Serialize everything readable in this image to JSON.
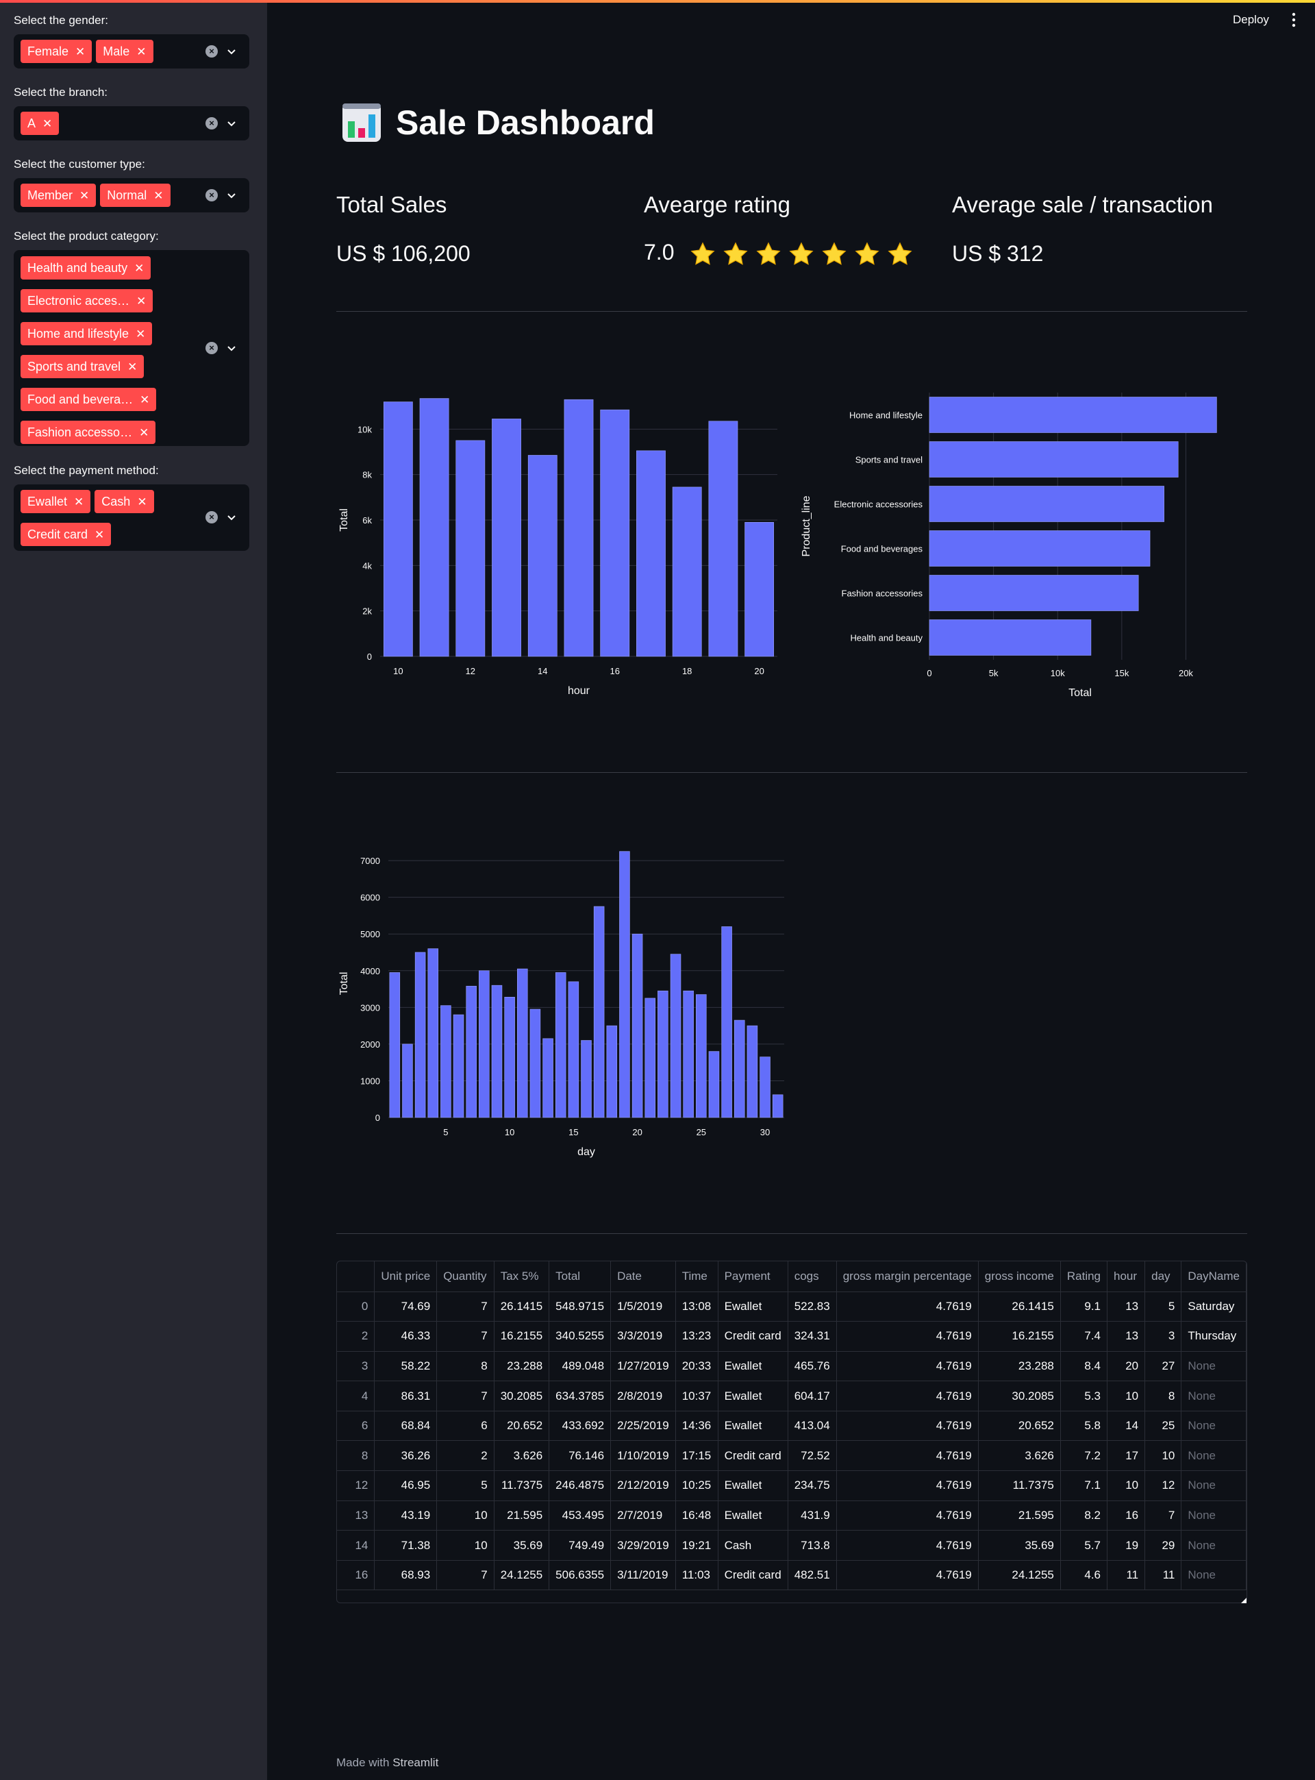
{
  "app": {
    "deploy_label": "Deploy",
    "title": "Sale Dashboard",
    "footer_prefix": "Made with",
    "footer_brand": "Streamlit"
  },
  "sidebar": {
    "gender": {
      "label": "Select the gender:",
      "selected": [
        "Female",
        "Male"
      ]
    },
    "branch": {
      "label": "Select the branch:",
      "selected": [
        "A"
      ]
    },
    "customer_type": {
      "label": "Select the customer type:",
      "selected": [
        "Member",
        "Normal"
      ]
    },
    "product_category": {
      "label": "Select the product category:",
      "selected": [
        "Health and beauty",
        "Electronic acces…",
        "Home and lifestyle",
        "Sports and travel",
        "Food and bevera…",
        "Fashion accesso…"
      ]
    },
    "payment_method": {
      "label": "Select the payment method:",
      "selected": [
        "Ewallet",
        "Cash",
        "Credit card"
      ]
    }
  },
  "metrics": {
    "total_sales": {
      "title": "Total Sales",
      "value": "US $ 106,200"
    },
    "avg_rating": {
      "title": "Avearge rating",
      "value": "7.0",
      "stars": 7
    },
    "avg_sale": {
      "title": "Average sale / transaction",
      "value": "US $ 312"
    }
  },
  "colors": {
    "bar": "#636efa",
    "chip": "#ff4b4b",
    "star": "#fdd835"
  },
  "chart_data": [
    {
      "type": "bar",
      "xlabel": "hour",
      "ylabel": "Total",
      "x": [
        10,
        11,
        12,
        13,
        14,
        15,
        16,
        17,
        18,
        19,
        20
      ],
      "values": [
        11200,
        11350,
        9500,
        10450,
        8850,
        11300,
        10850,
        9050,
        7450,
        10350,
        5900
      ],
      "xticks": [
        10,
        12,
        14,
        16,
        18,
        20
      ],
      "yticks": [
        "0",
        "2k",
        "4k",
        "6k",
        "8k",
        "10k"
      ],
      "ylim": [
        0,
        12000
      ]
    },
    {
      "type": "bar",
      "orientation": "horizontal",
      "xlabel": "Total",
      "ylabel": "Product_line",
      "categories": [
        "Home and lifestyle",
        "Sports and travel",
        "Electronic accessories",
        "Food and beverages",
        "Fashion accessories",
        "Health and beauty"
      ],
      "values": [
        22400,
        19400,
        18300,
        17200,
        16300,
        12600
      ],
      "xticks": [
        "0",
        "5k",
        "10k",
        "15k",
        "20k"
      ],
      "xlim": [
        0,
        23500
      ]
    },
    {
      "type": "bar",
      "xlabel": "day",
      "ylabel": "Total",
      "x": [
        1,
        2,
        3,
        4,
        5,
        6,
        7,
        8,
        9,
        10,
        11,
        12,
        13,
        14,
        15,
        16,
        17,
        18,
        19,
        20,
        21,
        22,
        23,
        24,
        25,
        26,
        27,
        28,
        29,
        30,
        31
      ],
      "values": [
        3950,
        2000,
        4500,
        4600,
        3050,
        2800,
        3580,
        4000,
        3600,
        3280,
        4050,
        2950,
        2150,
        3950,
        3700,
        2100,
        5750,
        2500,
        7250,
        5000,
        3250,
        3450,
        4450,
        3450,
        3350,
        1800,
        5200,
        2650,
        2500,
        1650,
        620
      ],
      "xticks": [
        5,
        10,
        15,
        20,
        25,
        30
      ],
      "yticks": [
        "0",
        "1000",
        "2000",
        "3000",
        "4000",
        "5000",
        "6000",
        "7000"
      ],
      "ylim": [
        0,
        7300
      ]
    }
  ],
  "table": {
    "columns": [
      "",
      "Unit price",
      "Quantity",
      "Tax 5%",
      "Total",
      "Date",
      "Time",
      "Payment",
      "cogs",
      "gross margin percentage",
      "gross income",
      "Rating",
      "hour",
      "day",
      "DayName"
    ],
    "rows": [
      [
        "0",
        "74.69",
        "7",
        "26.1415",
        "548.9715",
        "1/5/2019",
        "13:08",
        "Ewallet",
        "522.83",
        "4.7619",
        "26.1415",
        "9.1",
        "13",
        "5",
        "Saturday"
      ],
      [
        "2",
        "46.33",
        "7",
        "16.2155",
        "340.5255",
        "3/3/2019",
        "13:23",
        "Credit card",
        "324.31",
        "4.7619",
        "16.2155",
        "7.4",
        "13",
        "3",
        "Thursday"
      ],
      [
        "3",
        "58.22",
        "8",
        "23.288",
        "489.048",
        "1/27/2019",
        "20:33",
        "Ewallet",
        "465.76",
        "4.7619",
        "23.288",
        "8.4",
        "20",
        "27",
        "None"
      ],
      [
        "4",
        "86.31",
        "7",
        "30.2085",
        "634.3785",
        "2/8/2019",
        "10:37",
        "Ewallet",
        "604.17",
        "4.7619",
        "30.2085",
        "5.3",
        "10",
        "8",
        "None"
      ],
      [
        "6",
        "68.84",
        "6",
        "20.652",
        "433.692",
        "2/25/2019",
        "14:36",
        "Ewallet",
        "413.04",
        "4.7619",
        "20.652",
        "5.8",
        "14",
        "25",
        "None"
      ],
      [
        "8",
        "36.26",
        "2",
        "3.626",
        "76.146",
        "1/10/2019",
        "17:15",
        "Credit card",
        "72.52",
        "4.7619",
        "3.626",
        "7.2",
        "17",
        "10",
        "None"
      ],
      [
        "12",
        "46.95",
        "5",
        "11.7375",
        "246.4875",
        "2/12/2019",
        "10:25",
        "Ewallet",
        "234.75",
        "4.7619",
        "11.7375",
        "7.1",
        "10",
        "12",
        "None"
      ],
      [
        "13",
        "43.19",
        "10",
        "21.595",
        "453.495",
        "2/7/2019",
        "16:48",
        "Ewallet",
        "431.9",
        "4.7619",
        "21.595",
        "8.2",
        "16",
        "7",
        "None"
      ],
      [
        "14",
        "71.38",
        "10",
        "35.69",
        "749.49",
        "3/29/2019",
        "19:21",
        "Cash",
        "713.8",
        "4.7619",
        "35.69",
        "5.7",
        "19",
        "29",
        "None"
      ],
      [
        "16",
        "68.93",
        "7",
        "24.1255",
        "506.6355",
        "3/11/2019",
        "11:03",
        "Credit card",
        "482.51",
        "4.7619",
        "24.1255",
        "4.6",
        "11",
        "11",
        "None"
      ]
    ]
  }
}
